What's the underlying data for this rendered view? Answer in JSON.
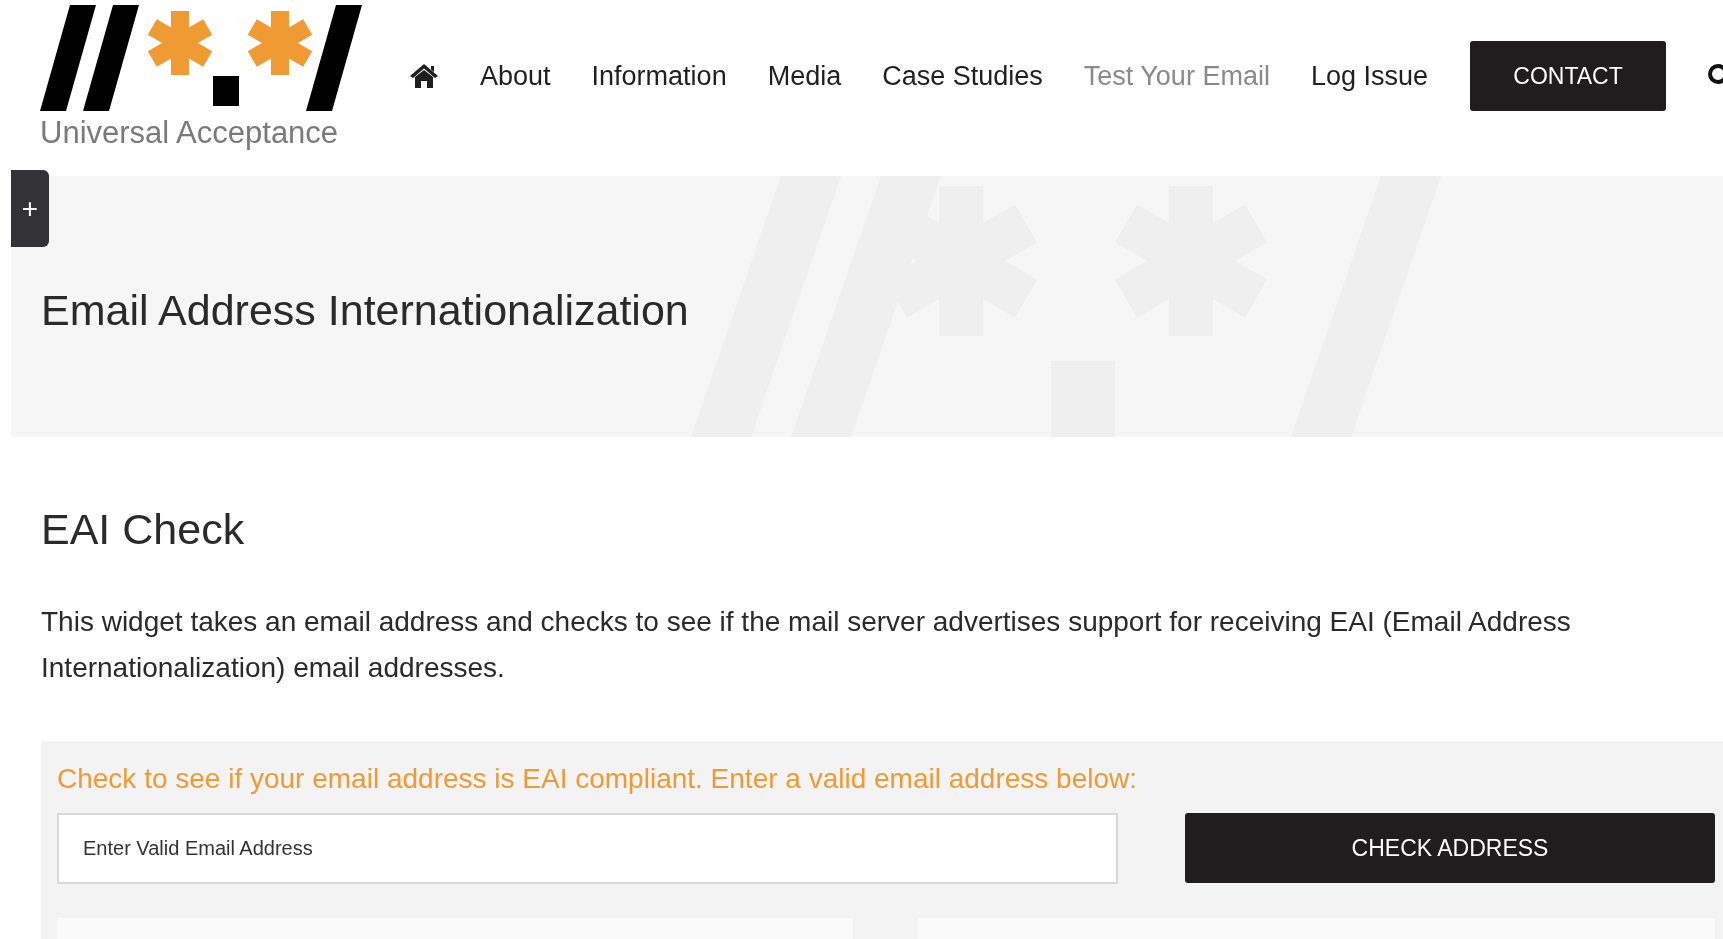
{
  "logo": {
    "tagline": "Universal Acceptance"
  },
  "nav": {
    "items": [
      {
        "label": "About",
        "selected": false
      },
      {
        "label": "Information",
        "selected": false
      },
      {
        "label": "Media",
        "selected": false
      },
      {
        "label": "Case Studies",
        "selected": false
      },
      {
        "label": "Test Your Email",
        "selected": true
      },
      {
        "label": "Log Issue",
        "selected": false
      }
    ],
    "contact_button": "CONTACT"
  },
  "side_toggle": "+",
  "hero": {
    "title": "Email Address Internationalization"
  },
  "section": {
    "heading": "EAI Check",
    "description": "This widget takes an email address and checks to see if the mail server advertises support for receiving EAI (Email Address Internationalization) email addresses."
  },
  "check_form": {
    "prompt": "Check to see if your email address is EAI compliant. Enter a valid email address below:",
    "email_field": {
      "placeholder": "Enter Valid Email Address"
    },
    "submit_button": "CHECK ADDRESS"
  }
}
